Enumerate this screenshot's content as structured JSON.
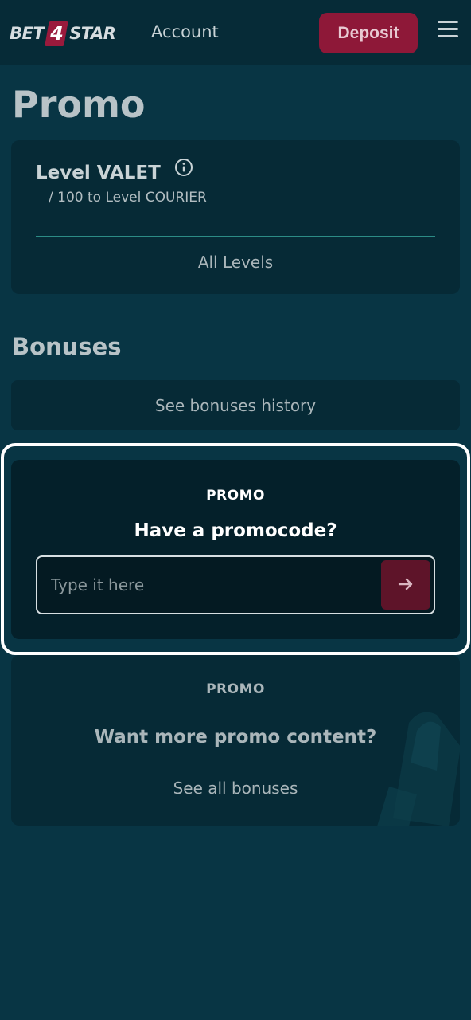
{
  "header": {
    "logo": {
      "part1": "BET",
      "part2": "4",
      "part3": "STAR"
    },
    "account_label": "Account",
    "deposit_label": "Deposit",
    "menu_icon": "hamburger-menu-icon"
  },
  "page": {
    "title": "Promo"
  },
  "level": {
    "title": "Level VALET",
    "info_icon": "info-icon",
    "subtitle": "/ 100 to Level COURIER",
    "progress_fraction": 1.0,
    "all_levels_label": "All Levels"
  },
  "bonuses": {
    "title": "Bonuses",
    "history_label": "See bonuses history"
  },
  "promo_code": {
    "label": "PROMO",
    "heading": "Have a promocode?",
    "input_value": "",
    "input_placeholder": "Type it here",
    "submit_icon": "arrow-right-icon"
  },
  "more_promo": {
    "label": "PROMO",
    "heading": "Want more promo content?",
    "link_label": "See all bonuses"
  },
  "colors": {
    "background": "#083544",
    "header": "#062b37",
    "card": "#062a36",
    "accent": "#8e1838",
    "progress": "#2c8c86"
  }
}
